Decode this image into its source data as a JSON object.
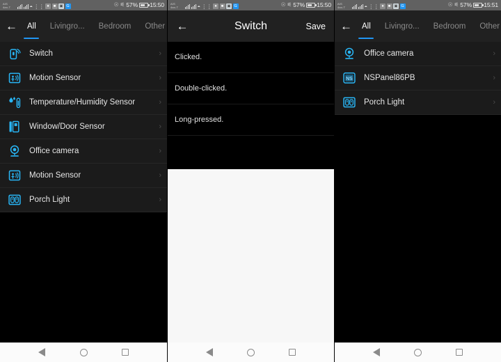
{
  "app": {
    "accent_color": "#29b6f6",
    "tab_indicator_color": "#2196f3",
    "background_color": "#000000",
    "list_background_color": "#1b1b1b",
    "bar_background_color": "#212121"
  },
  "panels": [
    {
      "status_bar": {
        "carrier_line1": "AIS",
        "carrier_line2": "4ax-T",
        "battery_percent": "57%",
        "time": "15:50"
      },
      "nav_tabs": {
        "back_icon": "back-arrow-icon",
        "items": [
          {
            "label": "All",
            "active": true
          },
          {
            "label": "Livingro...",
            "active": false
          },
          {
            "label": "Bedroom",
            "active": false
          },
          {
            "label": "Other",
            "active": false
          }
        ]
      },
      "devices": [
        {
          "label": "Switch",
          "icon": "switch-remote-icon",
          "chevron": "›"
        },
        {
          "label": "Motion Sensor",
          "icon": "motion-sensor-icon",
          "chevron": "›"
        },
        {
          "label": "Temperature/Humidity Sensor",
          "icon": "temperature-humidity-icon",
          "chevron": "›"
        },
        {
          "label": "Window/Door Sensor",
          "icon": "window-door-sensor-icon",
          "chevron": "›"
        },
        {
          "label": "Office camera",
          "icon": "camera-icon",
          "chevron": "›"
        },
        {
          "label": "Motion Sensor",
          "icon": "motion-sensor-icon",
          "chevron": "›"
        },
        {
          "label": "Porch Light",
          "icon": "dual-outlet-icon",
          "chevron": "›"
        }
      ]
    },
    {
      "status_bar": {
        "carrier_line1": "AIS",
        "carrier_line2": "4ax-T",
        "battery_percent": "57%",
        "time": "15:50"
      },
      "app_bar": {
        "back_icon": "back-arrow-icon",
        "title": "Switch",
        "action_label": "Save"
      },
      "actions": [
        {
          "label": "Clicked."
        },
        {
          "label": "Double-clicked."
        },
        {
          "label": "Long-pressed."
        }
      ]
    },
    {
      "status_bar": {
        "carrier_line1": "AIS",
        "carrier_line2": "4ax-T",
        "battery_percent": "57%",
        "time": "15:51"
      },
      "nav_tabs": {
        "back_icon": "back-arrow-icon",
        "items": [
          {
            "label": "All",
            "active": true
          },
          {
            "label": "Livingro...",
            "active": false
          },
          {
            "label": "Bedroom",
            "active": false
          },
          {
            "label": "Other",
            "active": false
          }
        ]
      },
      "devices": [
        {
          "label": "Office camera",
          "icon": "camera-icon",
          "chevron": "›"
        },
        {
          "label": "NSPanel86PB",
          "icon": "ns-panel-icon",
          "badge_text": "NS",
          "chevron": "›"
        },
        {
          "label": "Porch Light",
          "icon": "dual-outlet-icon",
          "chevron": "›"
        }
      ]
    }
  ],
  "system_nav": {
    "back": "back-triangle-icon",
    "home": "home-circle-icon",
    "recents": "recents-square-icon"
  }
}
